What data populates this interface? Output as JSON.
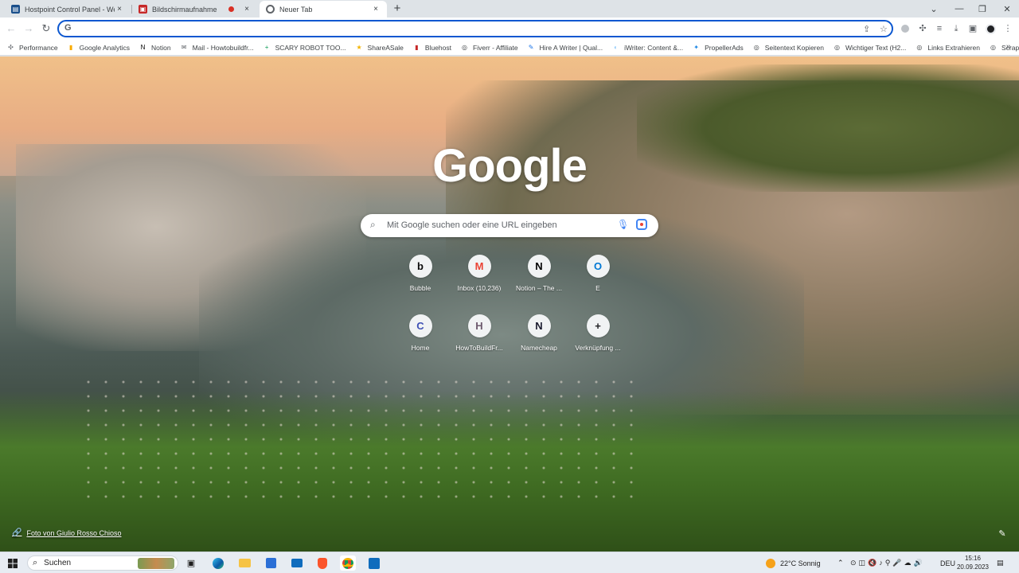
{
  "tabs": [
    {
      "label": "Hostpoint Control Panel - Webs",
      "icon": "hostpoint-icon",
      "close": "×"
    },
    {
      "label": "Bildschirmaufnahme",
      "icon": "recording-icon",
      "close": "×"
    },
    {
      "label": "Neuer Tab",
      "icon": "chrome-icon",
      "close": "×"
    }
  ],
  "new_tab": "+",
  "window_controls": {
    "dropdown": "⌄",
    "minimize": "—",
    "restore": "❐",
    "close": "✕"
  },
  "nav": {
    "back": "←",
    "forward": "→",
    "reload": "↻"
  },
  "omnibox": {
    "value": "",
    "google_glyph": "G"
  },
  "toolbar_icons": {
    "share": "⇪",
    "star": "☆",
    "extensions": "✣",
    "media": "≡",
    "download": "⤓",
    "sidepanel": "▣",
    "menu": "⋮"
  },
  "bookmarks": [
    {
      "label": "Performance",
      "icon": "puzzle-icon",
      "glyph": "✣",
      "color": "#5f6368"
    },
    {
      "label": "Google Analytics",
      "icon": "analytics-icon",
      "glyph": "▮",
      "color": "#f9ab00"
    },
    {
      "label": "Notion",
      "icon": "notion-icon",
      "glyph": "N",
      "color": "#000000"
    },
    {
      "label": "Mail - Howtobuildfr...",
      "icon": "mail-icon",
      "glyph": "✉",
      "color": "#5f6368"
    },
    {
      "label": "SCARY ROBOT TOO...",
      "icon": "sheets-icon",
      "glyph": "+",
      "color": "#0f9d58"
    },
    {
      "label": "ShareASale",
      "icon": "star-icon",
      "glyph": "★",
      "color": "#f4b400"
    },
    {
      "label": "Bluehost",
      "icon": "bluehost-icon",
      "glyph": "▮",
      "color": "#c62828"
    },
    {
      "label": "Fiverr - Affiliate",
      "icon": "globe-icon",
      "glyph": "◎",
      "color": "#3c4043"
    },
    {
      "label": "Hire A Writer | Qual...",
      "icon": "writer-icon",
      "glyph": "✎",
      "color": "#1a73e8"
    },
    {
      "label": "iWriter: Content &...",
      "icon": "iwriter-icon",
      "glyph": "◐",
      "color": "#90caf9"
    },
    {
      "label": "PropellerAds",
      "icon": "propeller-icon",
      "glyph": "✦",
      "color": "#1e88e5"
    },
    {
      "label": "Seitentext Kopieren",
      "icon": "globe-icon",
      "glyph": "◎",
      "color": "#3c4043"
    },
    {
      "label": "Wichtiger Text (H2...",
      "icon": "globe-icon",
      "glyph": "◎",
      "color": "#3c4043"
    },
    {
      "label": "Links Extrahieren",
      "icon": "globe-icon",
      "glyph": "◎",
      "color": "#3c4043"
    },
    {
      "label": "Scrape SERPs",
      "icon": "globe-icon",
      "glyph": "◎",
      "color": "#3c4043"
    }
  ],
  "bookmarks_more": "»",
  "newtab": {
    "logo": "Google",
    "search_placeholder": "Mit Google suchen oder eine URL eingeben",
    "shortcuts": [
      {
        "label": "Bubble",
        "glyph": "b",
        "color": "#0a0a0a"
      },
      {
        "label": "Inbox (10,236)",
        "glyph": "M",
        "color": "#ea4335"
      },
      {
        "label": "Notion – The ...",
        "glyph": "N",
        "color": "#000000"
      },
      {
        "label": "E",
        "glyph": "O",
        "color": "#0078d4"
      },
      {
        "label": "Home",
        "glyph": "C",
        "color": "#3f51b5"
      },
      {
        "label": "HowToBuildFr...",
        "glyph": "H",
        "color": "#6d5a6e"
      },
      {
        "label": "Namecheap",
        "glyph": "N",
        "color": "#1a1a2e"
      },
      {
        "label": "Verknüpfung ...",
        "glyph": "+",
        "color": "#202124"
      }
    ],
    "photo_credit": "Foto von Giulio Rosso Chioso"
  },
  "taskbar": {
    "search_label": "Suchen",
    "weather": "22°C  Sonnig",
    "lang": "DEU",
    "time": "15:16",
    "date": "20.09.2023"
  }
}
